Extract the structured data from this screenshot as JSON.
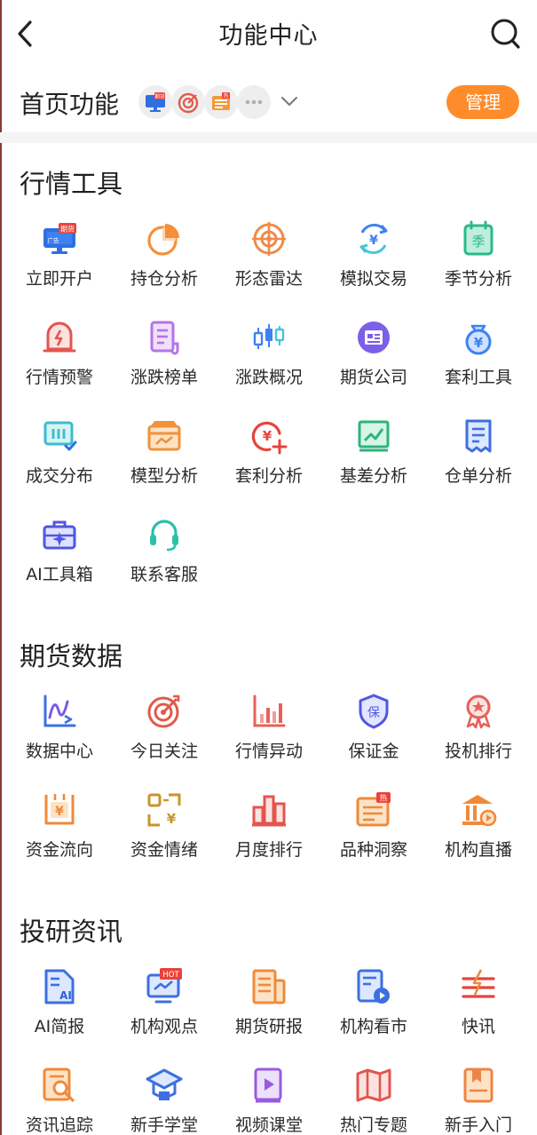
{
  "header": {
    "title": "功能中心",
    "back_icon": "back-arrow-icon",
    "search_icon": "search-icon"
  },
  "home": {
    "title": "首页功能",
    "mini_badge_text": [
      "期货",
      "热"
    ],
    "manage_label": "管理",
    "accent": "#ff8b2a"
  },
  "sections": [
    {
      "title": "行情工具",
      "items": [
        {
          "label": "立即开户",
          "icon": "open-account-icon",
          "badge": "期货",
          "badge2": "广告"
        },
        {
          "label": "持仓分析",
          "icon": "pie-chart-icon"
        },
        {
          "label": "形态雷达",
          "icon": "radar-icon"
        },
        {
          "label": "模拟交易",
          "icon": "exchange-icon"
        },
        {
          "label": "季节分析",
          "icon": "season-calendar-icon",
          "glyph": "季"
        },
        {
          "label": "行情预警",
          "icon": "alarm-icon"
        },
        {
          "label": "涨跌榜单",
          "icon": "list-scroll-icon"
        },
        {
          "label": "涨跌概况",
          "icon": "candlestick-icon"
        },
        {
          "label": "期货公司",
          "icon": "company-icon"
        },
        {
          "label": "套利工具",
          "icon": "money-bag-icon"
        },
        {
          "label": "成交分布",
          "icon": "trade-distribution-icon"
        },
        {
          "label": "模型分析",
          "icon": "model-box-icon"
        },
        {
          "label": "套利分析",
          "icon": "arbitrage-icon"
        },
        {
          "label": "基差分析",
          "icon": "basis-chart-icon"
        },
        {
          "label": "仓单分析",
          "icon": "warehouse-receipt-icon"
        },
        {
          "label": "AI工具箱",
          "icon": "toolbox-icon"
        },
        {
          "label": "联系客服",
          "icon": "headset-icon"
        }
      ]
    },
    {
      "title": "期货数据",
      "items": [
        {
          "label": "数据中心",
          "icon": "data-center-icon"
        },
        {
          "label": "今日关注",
          "icon": "target-icon"
        },
        {
          "label": "行情异动",
          "icon": "bar-chart-icon"
        },
        {
          "label": "保证金",
          "icon": "shield-icon",
          "glyph": "保"
        },
        {
          "label": "投机排行",
          "icon": "medal-icon"
        },
        {
          "label": "资金流向",
          "icon": "fund-flow-icon"
        },
        {
          "label": "资金情绪",
          "icon": "fund-sentiment-icon"
        },
        {
          "label": "月度排行",
          "icon": "monthly-rank-icon"
        },
        {
          "label": "品种洞察",
          "icon": "insight-card-icon",
          "badge": "热"
        },
        {
          "label": "机构直播",
          "icon": "institution-live-icon"
        }
      ]
    },
    {
      "title": "投研资讯",
      "items": [
        {
          "label": "AI简报",
          "icon": "ai-brief-icon",
          "glyph": "AI"
        },
        {
          "label": "机构观点",
          "icon": "monitor-hot-icon",
          "badge": "HOT"
        },
        {
          "label": "期货研报",
          "icon": "research-report-icon"
        },
        {
          "label": "机构看市",
          "icon": "market-view-icon"
        },
        {
          "label": "快讯",
          "icon": "flash-news-icon"
        },
        {
          "label": "资讯追踪",
          "icon": "news-track-icon"
        },
        {
          "label": "新手学堂",
          "icon": "school-icon"
        },
        {
          "label": "视频课堂",
          "icon": "video-book-icon"
        },
        {
          "label": "热门专题",
          "icon": "hot-topic-map-icon"
        },
        {
          "label": "新手入门",
          "icon": "beginner-book-icon"
        }
      ]
    }
  ]
}
